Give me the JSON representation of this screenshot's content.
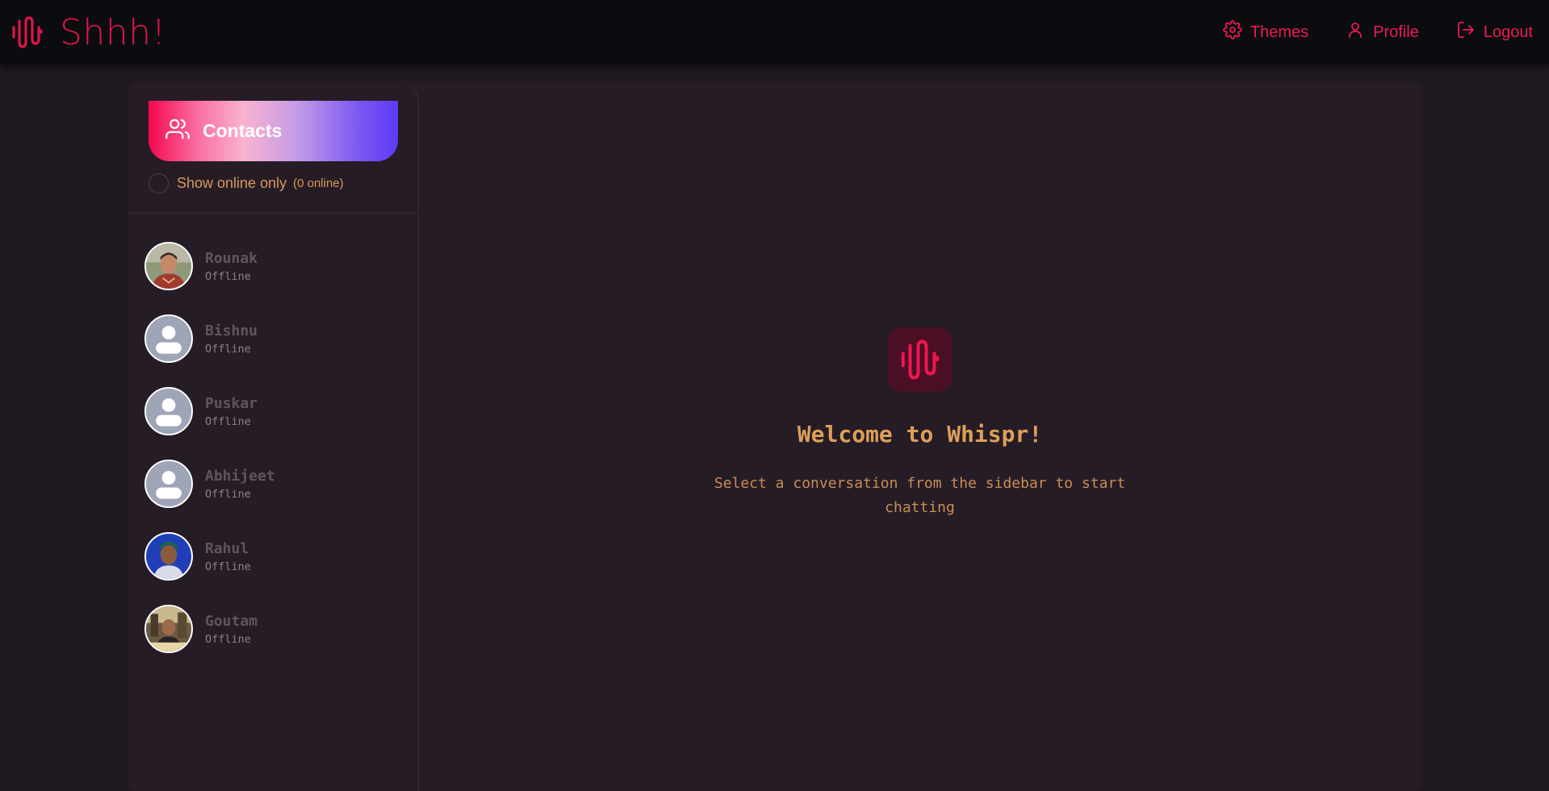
{
  "navbar": {
    "brand": "Shhh!",
    "actions": [
      {
        "label": "Themes",
        "icon": "gear-icon"
      },
      {
        "label": "Profile",
        "icon": "user-icon"
      },
      {
        "label": "Logout",
        "icon": "logout-icon"
      }
    ]
  },
  "sidebar": {
    "title": "Contacts",
    "filter_label": "Show online only",
    "online_count": "(0 online)",
    "contacts": [
      {
        "name": "Rounak",
        "status": "Offline",
        "avatar": "photo"
      },
      {
        "name": "Bishnu",
        "status": "Offline",
        "avatar": "default"
      },
      {
        "name": "Puskar",
        "status": "Offline",
        "avatar": "default"
      },
      {
        "name": "Abhijeet",
        "status": "Offline",
        "avatar": "default"
      },
      {
        "name": "Rahul",
        "status": "Offline",
        "avatar": "photo"
      },
      {
        "name": "Goutam",
        "status": "Offline",
        "avatar": "photo"
      }
    ]
  },
  "main": {
    "welcome_title": "Welcome to Whispr!",
    "welcome_subtitle": "Select a conversation from the sidebar to start chatting"
  },
  "colors": {
    "accent": "#e0144a",
    "background": "#201920",
    "navbar": "#0a0c10",
    "panel": "#261c26",
    "warm_text": "#d79a58"
  }
}
